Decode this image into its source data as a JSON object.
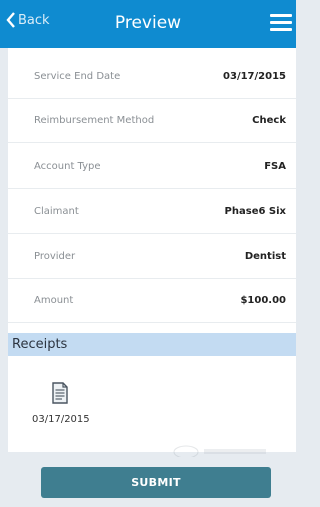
{
  "nav": {
    "back_label": "Back",
    "title": "Preview"
  },
  "details": [
    {
      "label": "Service End Date",
      "value": "03/17/2015"
    },
    {
      "label": "Reimbursement Method",
      "value": "Check"
    },
    {
      "label": "Account Type",
      "value": "FSA"
    },
    {
      "label": "Claimant",
      "value": "Phase6 Six"
    },
    {
      "label": "Provider",
      "value": "Dentist"
    },
    {
      "label": "Amount",
      "value": "$100.00"
    }
  ],
  "receipts": {
    "header": "Receipts",
    "items": [
      {
        "date": "03/17/2015",
        "icon": "document-icon"
      }
    ]
  },
  "footer": {
    "submit_label": "SUBMIT"
  },
  "colors": {
    "nav_bg": "#0f8bd0",
    "section_header_bg": "#c3dbf2",
    "submit_bg": "#3f7e90",
    "page_bg": "#e6ebf0"
  }
}
